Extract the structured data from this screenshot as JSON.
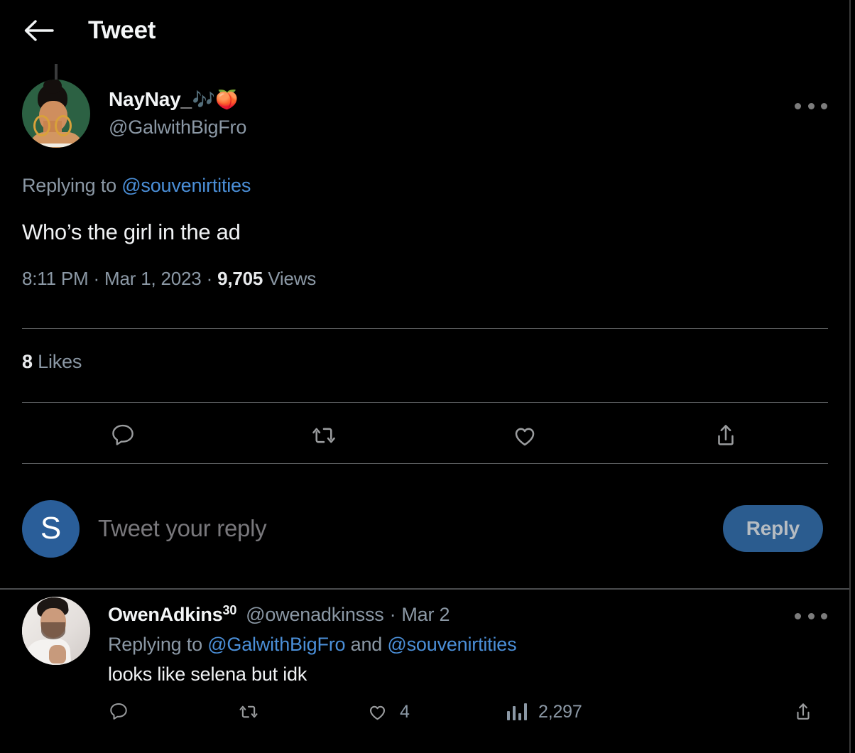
{
  "window": {
    "background": "#000000",
    "accent": "#1d9bf0",
    "link_color": "#4b8fd8",
    "muted_text": "#8b98a5"
  },
  "header": {
    "back_icon": "back-arrow-icon",
    "title": "Tweet"
  },
  "main_tweet": {
    "avatar_alt": "NayNay avatar illustration",
    "display_name": "NayNay_",
    "name_emoji": "🎶🍑",
    "handle": "@GalwithBigFro",
    "more_icon": "more-options-icon",
    "replying_prefix": "Replying to ",
    "replying_to": "@souvenirtities",
    "text": "Who’s the girl in the ad",
    "time": "8:11 PM",
    "separator": " · ",
    "date": "Mar 1, 2023",
    "views_count": "9,705",
    "views_label": "Views",
    "likes_count": "8",
    "likes_label": "Likes",
    "actions": [
      {
        "name": "reply-icon",
        "label": "Reply",
        "count": ""
      },
      {
        "name": "retweet-icon",
        "label": "Retweet",
        "count": ""
      },
      {
        "name": "like-icon",
        "label": "Like",
        "count": ""
      },
      {
        "name": "share-icon",
        "label": "Share",
        "count": ""
      }
    ]
  },
  "composer": {
    "avatar_initial": "S",
    "placeholder": "Tweet your reply",
    "reply_button_label": "Reply",
    "button_color": "#2b5c8f"
  },
  "reply_tweet": {
    "avatar_alt": "OwenAdkins profile photo",
    "display_name": "OwenAdkins",
    "name_superscript": "30",
    "handle": "@owenadkinsss",
    "dot": "·",
    "date": "Mar 2",
    "more_icon": "more-options-icon",
    "replying_prefix": "Replying to ",
    "replying_to_1": "@GalwithBigFro",
    "replying_and": " and ",
    "replying_to_2": "@souvenirtities",
    "text": "looks like selena but idk",
    "actions": {
      "reply": {
        "icon": "reply-icon",
        "count": ""
      },
      "retweet": {
        "icon": "retweet-icon",
        "count": ""
      },
      "like": {
        "icon": "like-icon",
        "count": "4"
      },
      "views": {
        "icon": "analytics-bars-icon",
        "count": "2,297"
      },
      "share": {
        "icon": "share-icon",
        "count": ""
      }
    }
  }
}
